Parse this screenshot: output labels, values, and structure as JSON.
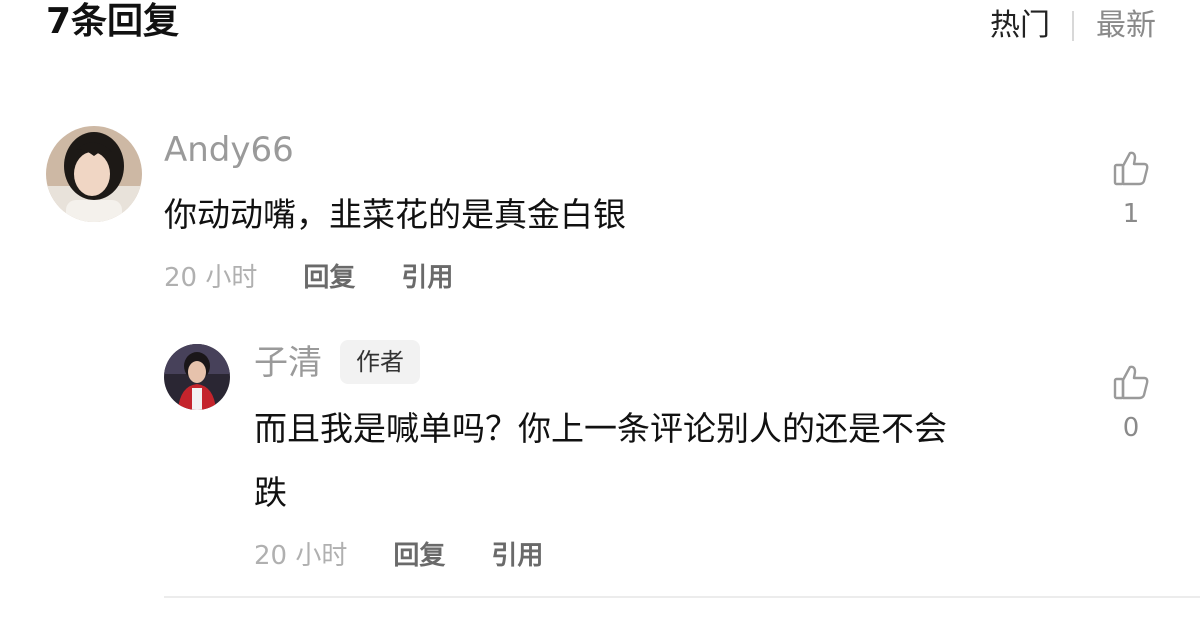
{
  "header": {
    "title": "7条回复",
    "sort_hot": "热门",
    "sort_new": "最新"
  },
  "comment": {
    "username": "Andy66",
    "text": "你动动嘴，韭菜花的是真金白银",
    "time": "20 小时",
    "reply_label": "回复",
    "quote_label": "引用",
    "like_count": "1"
  },
  "reply": {
    "username": "子清",
    "badge": "作者",
    "text_line1": "而且我是喊单吗？你上一条评论别人的还是不会",
    "text_line2": "跌",
    "time": "20 小时",
    "reply_label": "回复",
    "quote_label": "引用",
    "like_count": "0"
  },
  "colors": {
    "muted_text": "#9a9a9a",
    "action_text": "#6a6a6a",
    "badge_bg": "#f2f2f2"
  },
  "icons": [
    "thumbs-up-icon"
  ]
}
